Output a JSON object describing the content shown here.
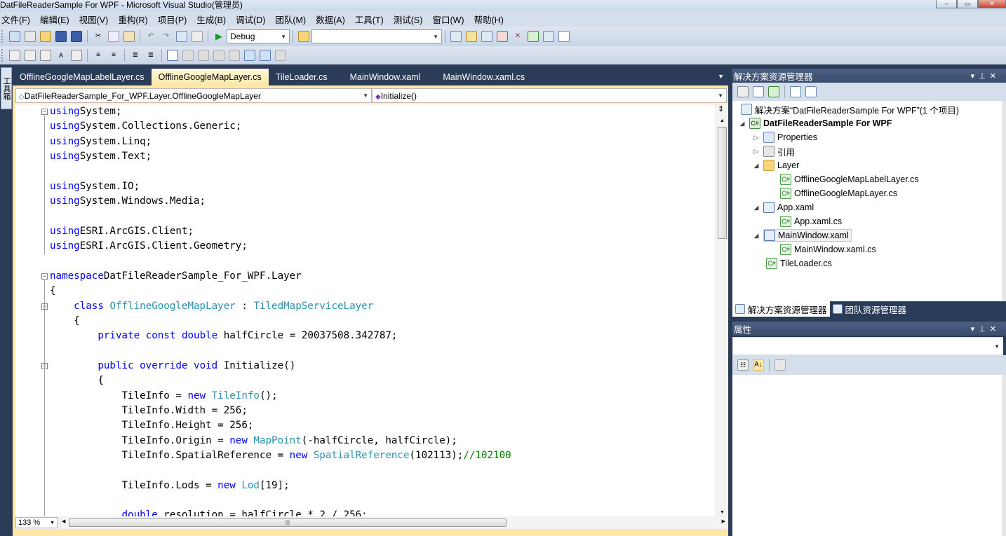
{
  "window": {
    "title": "DatFileReaderSample For WPF - Microsoft Visual Studio(管理员)"
  },
  "menu": [
    "文件(F)",
    "编辑(E)",
    "视图(V)",
    "重构(R)",
    "项目(P)",
    "生成(B)",
    "调试(D)",
    "团队(M)",
    "数据(A)",
    "工具(T)",
    "测试(S)",
    "窗口(W)",
    "帮助(H)"
  ],
  "toolbar": {
    "config_value": "Debug",
    "platform_value": ""
  },
  "toolbox_label": "工具箱",
  "tabs": [
    "OfflineGoogleMapLabelLayer.cs",
    "OfflineGoogleMapLayer.cs",
    "TileLoader.cs",
    "MainWindow.xaml",
    "MainWindow.xaml.cs"
  ],
  "active_tab": "OfflineGoogleMapLayer.cs",
  "nav": {
    "type": "DatFileReaderSample_For_WPF.Layer.OfflineGoogleMapLayer",
    "member": "Initialize()"
  },
  "code_lines": [
    [
      [
        "kw",
        "using"
      ],
      [
        "",
        "System;"
      ]
    ],
    [
      [
        "kw",
        "using"
      ],
      [
        "",
        "System.Collections.Generic;"
      ]
    ],
    [
      [
        "kw",
        "using"
      ],
      [
        "",
        "System.Linq;"
      ]
    ],
    [
      [
        "kw",
        "using"
      ],
      [
        "",
        "System.Text;"
      ]
    ],
    [],
    [
      [
        "kw",
        "using"
      ],
      [
        "",
        "System.IO;"
      ]
    ],
    [
      [
        "kw",
        "using"
      ],
      [
        "",
        "System.Windows.Media;"
      ]
    ],
    [],
    [
      [
        "kw",
        "using"
      ],
      [
        "",
        "ESRI.ArcGIS.Client;"
      ]
    ],
    [
      [
        "kw",
        "using"
      ],
      [
        "",
        "ESRI.ArcGIS.Client.Geometry;"
      ]
    ],
    [],
    [
      [
        "kw",
        "namespace"
      ],
      [
        "",
        "DatFileReaderSample_For_WPF.Layer"
      ]
    ],
    [
      [
        "",
        "{"
      ]
    ],
    [
      [
        "",
        "    "
      ],
      [
        "kw",
        "class"
      ],
      [
        "",
        " "
      ],
      [
        "ty",
        "OfflineGoogleMapLayer"
      ],
      [
        "",
        " : "
      ],
      [
        "ty",
        "TiledMapServiceLayer"
      ]
    ],
    [
      [
        "",
        "    {"
      ]
    ],
    [
      [
        "",
        "        "
      ],
      [
        "kw",
        "private"
      ],
      [
        "",
        " "
      ],
      [
        "kw",
        "const"
      ],
      [
        "",
        " "
      ],
      [
        "kw",
        "double"
      ],
      [
        "",
        " halfCircle = 20037508.342787;"
      ]
    ],
    [],
    [
      [
        "",
        "        "
      ],
      [
        "kw",
        "public"
      ],
      [
        "",
        " "
      ],
      [
        "kw",
        "override"
      ],
      [
        "",
        " "
      ],
      [
        "kw",
        "void"
      ],
      [
        "",
        " Initialize()"
      ]
    ],
    [
      [
        "",
        "        {"
      ]
    ],
    [
      [
        "",
        "            TileInfo = "
      ],
      [
        "kw",
        "new"
      ],
      [
        "",
        " "
      ],
      [
        "ty",
        "TileInfo"
      ],
      [
        "",
        "();"
      ]
    ],
    [
      [
        "",
        "            TileInfo.Width = 256;"
      ]
    ],
    [
      [
        "",
        "            TileInfo.Height = 256;"
      ]
    ],
    [
      [
        "",
        "            TileInfo.Origin = "
      ],
      [
        "kw",
        "new"
      ],
      [
        "",
        " "
      ],
      [
        "ty",
        "MapPoint"
      ],
      [
        "",
        "(-halfCircle, halfCircle);"
      ]
    ],
    [
      [
        "",
        "            TileInfo.SpatialReference = "
      ],
      [
        "kw",
        "new"
      ],
      [
        "",
        " "
      ],
      [
        "ty",
        "SpatialReference"
      ],
      [
        "",
        "(102113);"
      ],
      [
        "cm",
        "//102100"
      ]
    ],
    [],
    [
      [
        "",
        "            TileInfo.Lods = "
      ],
      [
        "kw",
        "new"
      ],
      [
        "",
        " "
      ],
      [
        "ty",
        "Lod"
      ],
      [
        "",
        "[19];"
      ]
    ],
    [],
    [
      [
        "",
        "            "
      ],
      [
        "kw",
        "double"
      ],
      [
        "",
        " resolution = halfCircle * 2 / 256;"
      ]
    ]
  ],
  "zoom": "133 %",
  "solution_explorer": {
    "title": "解决方案资源管理器",
    "solution": "解决方案“DatFileReaderSample For WPF”(1 个项目)",
    "project": "DatFileReaderSample For WPF",
    "properties": "Properties",
    "references": "引用",
    "folder": "Layer",
    "files": {
      "label_layer": "OfflineGoogleMapLabelLayer.cs",
      "map_layer": "OfflineGoogleMapLayer.cs",
      "app_xaml": "App.xaml",
      "app_cs": "App.xaml.cs",
      "main_xaml": "MainWindow.xaml",
      "main_cs": "MainWindow.xaml.cs",
      "tile_loader": "TileLoader.cs"
    }
  },
  "bottom_tabs": {
    "solution": "解决方案资源管理器",
    "team": "团队资源管理器"
  },
  "properties_panel": {
    "title": "属性"
  }
}
